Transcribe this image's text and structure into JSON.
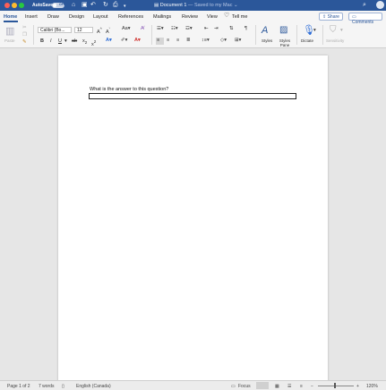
{
  "titlebar": {
    "autosave_label": "AutoSave",
    "autosave_state": "OFF",
    "doc_name": "Document 1",
    "doc_status": "— Saved to my Mac"
  },
  "tabs": {
    "items": [
      "Home",
      "Insert",
      "Draw",
      "Design",
      "Layout",
      "References",
      "Mailings",
      "Review",
      "View"
    ],
    "active": "Home",
    "tell_me": "Tell me",
    "share": "Share",
    "comments": "Comments"
  },
  "ribbon": {
    "paste_label": "Paste",
    "font_name": "Calibri (Bo...",
    "font_size": "12",
    "styles_label": "Styles",
    "styles_pane_label": "Styles Pane",
    "dictate_label": "Dictate",
    "sensitivity_label": "Sensitivity"
  },
  "document": {
    "question": "What is the answer to this question?",
    "answer_value": ""
  },
  "status": {
    "page": "Page 1 of 2",
    "words": "7 words",
    "language": "English (Canada)",
    "focus": "Focus",
    "zoom_percent": "120%"
  }
}
